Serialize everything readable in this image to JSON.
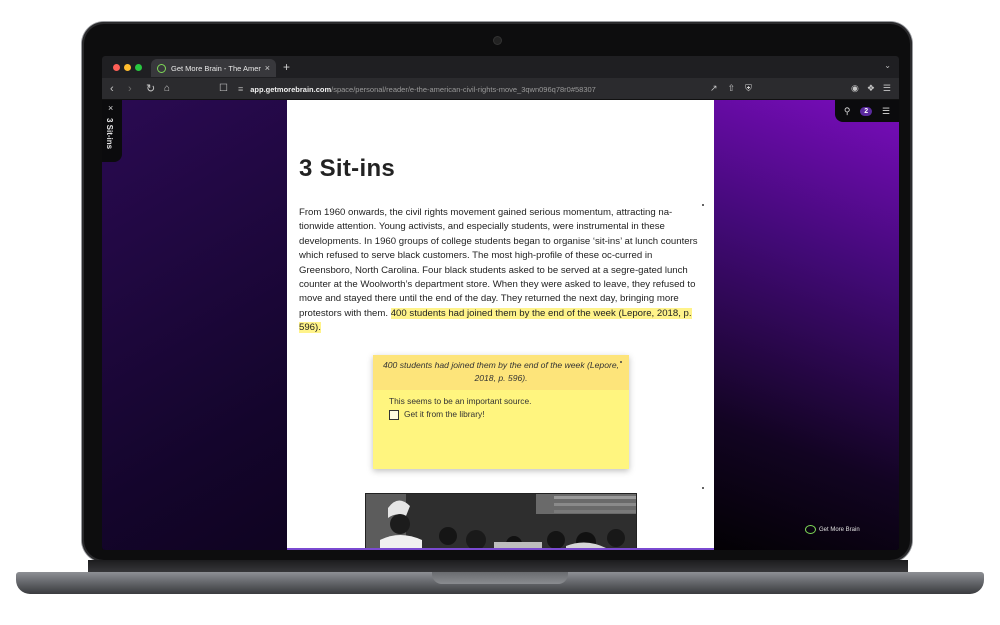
{
  "browser": {
    "tab_title": "Get More Brain - The American",
    "tab_close": "×",
    "new_tab": "+",
    "address_domain": "app.getmorebrain.com",
    "address_path": "/space/personal/reader/e-the-american-civil-rights-move_3qwn096q78r0#58307"
  },
  "reader": {
    "chapter_label": "3 Sit-ins",
    "chapter_close": "×",
    "highlight_count": "2",
    "brand": "Get More Brain"
  },
  "document": {
    "title": "3  Sit-ins",
    "paragraph": "From 1960 onwards, the civil rights movement gained serious momentum, attracting na-tionwide attention. Young activists, and especially students, were instrumental in these developments. In 1960 groups of college students began to organise ‘sit-ins’ at lunch counters which refused to serve black customers. The most high-profile of these oc-curred in Greensboro, North Carolina. Four black students asked to be served at a segre-gated lunch counter at the Woolworth’s department store. When they were asked to leave, they refused to move and stayed there until the end of the day. They returned the next day, bringing more protestors with them. ",
    "highlight": "400 students had joined them by the end of the week (Lepore, 2018, p. 596)."
  },
  "note": {
    "quote": "400 students had joined them by the end of the week (Lepore, 2018, p. 596).",
    "comment": "This seems to be an important source.",
    "task": "Get it from the library!",
    "task_checked": false,
    "color": "#fff57f"
  },
  "colors": {
    "highlight": "#fff38a",
    "accent": "#7a0cbd",
    "brand_green": "#7ed957"
  }
}
